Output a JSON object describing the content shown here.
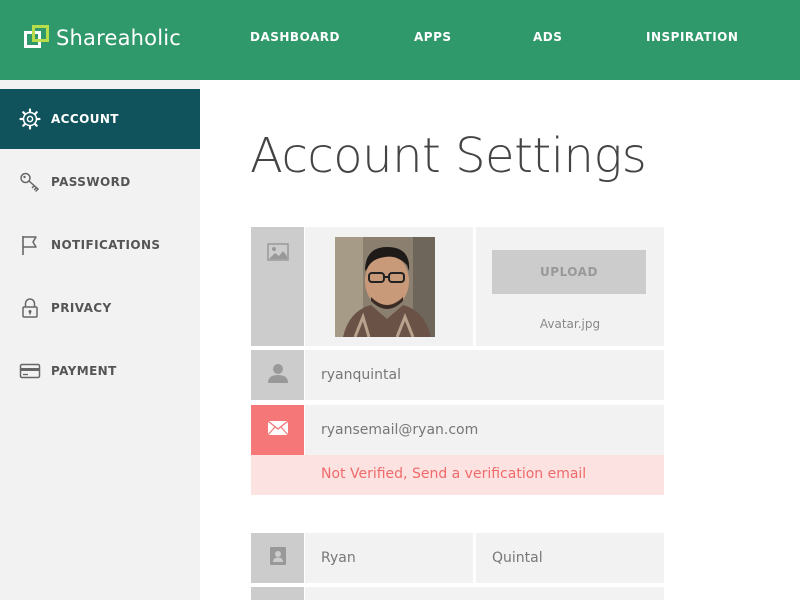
{
  "header": {
    "brand": "Shareaholic",
    "nav": {
      "dashboard": "DASHBOARD",
      "apps": "APPS",
      "ads": "ADS",
      "inspiration": "INSPIRATION"
    }
  },
  "sidebar": {
    "items": [
      {
        "label": "ACCOUNT",
        "icon": "gear-icon",
        "active": true
      },
      {
        "label": "PASSWORD",
        "icon": "key-icon",
        "active": false
      },
      {
        "label": "NOTIFICATIONS",
        "icon": "flag-icon",
        "active": false
      },
      {
        "label": "PRIVACY",
        "icon": "lock-icon",
        "active": false
      },
      {
        "label": "PAYMENT",
        "icon": "credit-card-icon",
        "active": false
      }
    ]
  },
  "main": {
    "title": "Account Settings",
    "avatar": {
      "upload_label": "UPLOAD",
      "filename": "Avatar.jpg"
    },
    "username": "ryanquintal",
    "email": "ryansemail@ryan.com",
    "verify_message": "Not Verified, Send a verification email",
    "first_name": "Ryan",
    "last_name": "Quintal"
  },
  "colors": {
    "brand_green": "#30996b",
    "sidebar_active": "#11535c",
    "sidebar_bg": "#f2f2f2",
    "field_bg": "#f2f2f2",
    "icon_cell": "#cccccc",
    "alert_red": "#f57777",
    "alert_bg": "#fde2e2"
  }
}
